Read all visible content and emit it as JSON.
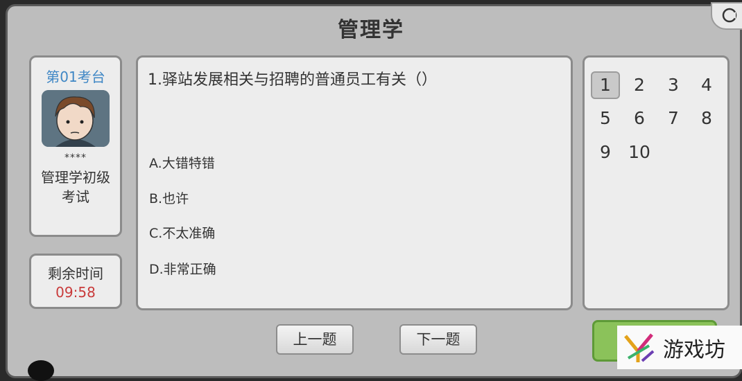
{
  "title": "管理学",
  "profile": {
    "seat": "第01考台",
    "name": "****",
    "exam": "管理学初级考试"
  },
  "timer": {
    "label": "剩余时间",
    "value": "09:58"
  },
  "question": {
    "text": "1.驿站发展相关与招聘的普通员工有关（）",
    "options": [
      "A.大错特错",
      "B.也许",
      "C.不太准确",
      "D.非常正确"
    ]
  },
  "question_nav": {
    "numbers": [
      "1",
      "2",
      "3",
      "4",
      "5",
      "6",
      "7",
      "8",
      "9",
      "10"
    ],
    "current": "1"
  },
  "buttons": {
    "prev": "上一题",
    "next": "下一题"
  },
  "watermark": {
    "text": "游戏坊"
  },
  "colors": {
    "timer": "#c93b3b",
    "seat": "#3f87c5",
    "submit": "#8bc25a"
  }
}
